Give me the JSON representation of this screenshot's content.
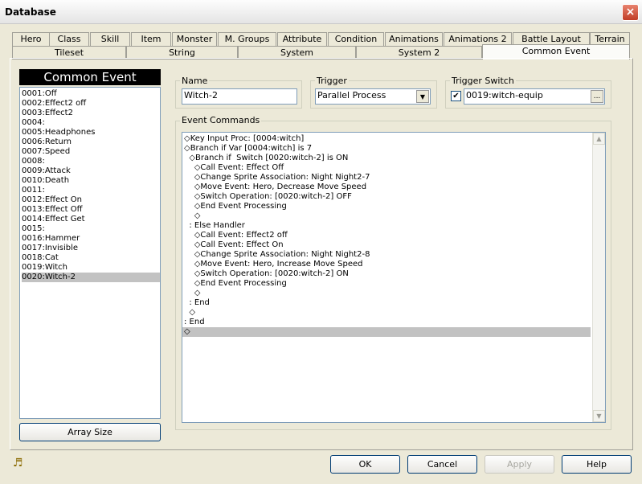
{
  "window": {
    "title": "Database",
    "close_icon": "×"
  },
  "tabs_row1": [
    "Hero",
    "Class",
    "Skill",
    "Item",
    "Monster",
    "M. Groups",
    "Attribute",
    "Condition",
    "Animations",
    "Animations 2",
    "Battle Layout",
    "Terrain"
  ],
  "tabs_row2": [
    "Tileset",
    "String",
    "System",
    "System 2",
    "Common Event"
  ],
  "active_tab": "Common Event",
  "left": {
    "header": "Common Event",
    "events": [
      "0001:Off",
      "0002:Effect2 off",
      "0003:Effect2",
      "0004:",
      "0005:Headphones",
      "0006:Return",
      "0007:Speed",
      "0008:",
      "0009:Attack",
      "0010:Death",
      "0011:",
      "0012:Effect On",
      "0013:Effect Off",
      "0014:Effect Get",
      "0015:",
      "0016:Hammer",
      "0017:Invisible",
      "0018:Cat",
      "0019:Witch",
      "0020:Witch-2"
    ],
    "selected_event": "0020:Witch-2",
    "array_size_button": "Array Size"
  },
  "form": {
    "name_label": "Name",
    "name_value": "Witch-2",
    "trigger_label": "Trigger",
    "trigger_value": "Parallel Process",
    "trigger_switch_label": "Trigger Switch",
    "trigger_switch_checked": true,
    "trigger_switch_value": "0019:witch-equip",
    "ellipsis_button": "...",
    "event_commands_label": "Event Commands"
  },
  "commands": [
    "◇Key Input Proc: [0004:witch]",
    "◇Branch if Var [0004:witch] is 7",
    "  ◇Branch if  Switch [0020:witch-2] is ON",
    "    ◇Call Event: Effect Off",
    "    ◇Change Sprite Association: Night Night2-7",
    "    ◇Move Event: Hero, Decrease Move Speed",
    "    ◇Switch Operation: [0020:witch-2] OFF",
    "    ◇End Event Processing",
    "    ◇",
    "  : Else Handler",
    "    ◇Call Event: Effect2 off",
    "    ◇Call Event: Effect On",
    "    ◇Change Sprite Association: Night Night2-8",
    "    ◇Move Event: Hero, Increase Move Speed",
    "    ◇Switch Operation: [0020:witch-2] ON",
    "    ◇End Event Processing",
    "    ◇",
    "  : End",
    "  ◇",
    ": End",
    "◇"
  ],
  "buttons": {
    "ok": "OK",
    "cancel": "Cancel",
    "apply": "Apply",
    "help": "Help"
  },
  "icons": {
    "music": "♬",
    "dropdown": "▼",
    "scroll_up": "▲",
    "scroll_down": "▼",
    "check": "✔"
  },
  "colors": {
    "selection": "#c2c2c2",
    "header_bg": "#000000",
    "close_bg": "#c13d26"
  }
}
